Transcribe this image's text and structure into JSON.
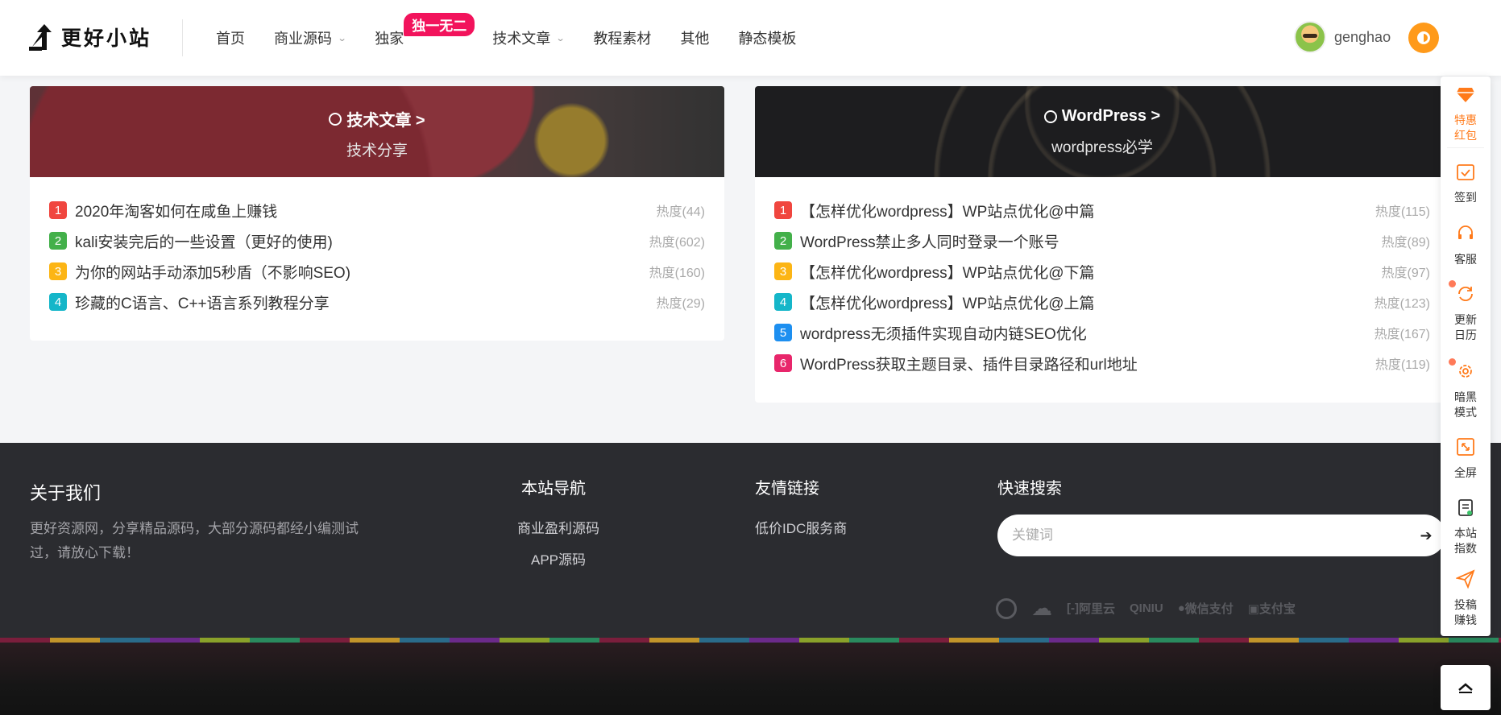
{
  "header": {
    "logo_text": "更好小站",
    "nav": [
      {
        "label": "首页",
        "has_dropdown": false
      },
      {
        "label": "商业源码",
        "has_dropdown": true
      },
      {
        "label": "独家",
        "has_dropdown": false,
        "badge": "独一无二"
      },
      {
        "label": "技术文章",
        "has_dropdown": true
      },
      {
        "label": "教程素材",
        "has_dropdown": false
      },
      {
        "label": "其他",
        "has_dropdown": false
      },
      {
        "label": "静态模板",
        "has_dropdown": false
      }
    ],
    "username": "genghao"
  },
  "cards": [
    {
      "title": "技术文章 >",
      "subtitle": "技术分享",
      "items": [
        {
          "rank": "1",
          "title": "2020年淘客如何在咸鱼上赚钱",
          "heat": "热度(44)"
        },
        {
          "rank": "2",
          "title": "kali安装完后的一些设置（更好的使用)",
          "heat": "热度(602)"
        },
        {
          "rank": "3",
          "title": "为你的网站手动添加5秒盾（不影响SEO)",
          "heat": "热度(160)"
        },
        {
          "rank": "4",
          "title": "珍藏的C语言、C++语言系列教程分享",
          "heat": "热度(29)"
        }
      ]
    },
    {
      "title": "WordPress >",
      "subtitle": "wordpress必学",
      "items": [
        {
          "rank": "1",
          "title": "【怎样优化wordpress】WP站点优化@中篇",
          "heat": "热度(115)"
        },
        {
          "rank": "2",
          "title": "WordPress禁止多人同时登录一个账号",
          "heat": "热度(89)"
        },
        {
          "rank": "3",
          "title": "【怎样优化wordpress】WP站点优化@下篇",
          "heat": "热度(97)"
        },
        {
          "rank": "4",
          "title": "【怎样优化wordpress】WP站点优化@上篇",
          "heat": "热度(123)"
        },
        {
          "rank": "5",
          "title": "wordpress无须插件实现自动内链SEO优化",
          "heat": "热度(167)"
        },
        {
          "rank": "6",
          "title": "WordPress获取主题目录、插件目录路径和url地址",
          "heat": "热度(119)"
        }
      ]
    }
  ],
  "rank_colors": [
    "#f0463f",
    "#43b04a",
    "#fcb515",
    "#15b6c9",
    "#1d8ff0",
    "#e8266b"
  ],
  "footer": {
    "about_title": "关于我们",
    "about_text": "更好资源网，分享精品源码，大部分源码都经小编测试过，请放心下载！",
    "nav_title": "本站导航",
    "nav_links": [
      "商业盈利源码",
      "APP源码"
    ],
    "links_title": "友情链接",
    "links": [
      "低价IDC服务商"
    ],
    "search_title": "快速搜索",
    "search_placeholder": "关键词",
    "partners": [
      "阿里云",
      "QINIU",
      "微信支付",
      "支付宝"
    ]
  },
  "sidebar": [
    {
      "label": "特惠红包",
      "icon": "diamond-icon",
      "hot": true
    },
    {
      "label": "签到",
      "icon": "calendar-check-icon"
    },
    {
      "label": "客服",
      "icon": "headset-icon"
    },
    {
      "label": "更新日历",
      "icon": "refresh-icon",
      "dot": true
    },
    {
      "label": "暗黑模式",
      "icon": "gear-icon",
      "dot": true
    },
    {
      "label": "全屏",
      "icon": "fullscreen-icon"
    },
    {
      "label": "本站指数",
      "icon": "clipboard-icon"
    },
    {
      "label": "投稿赚钱",
      "icon": "paper-plane-icon"
    }
  ],
  "colors": {
    "accent": "#ff7a1a",
    "footer_bg": "#2b2c30",
    "badge": "#f2135c"
  }
}
